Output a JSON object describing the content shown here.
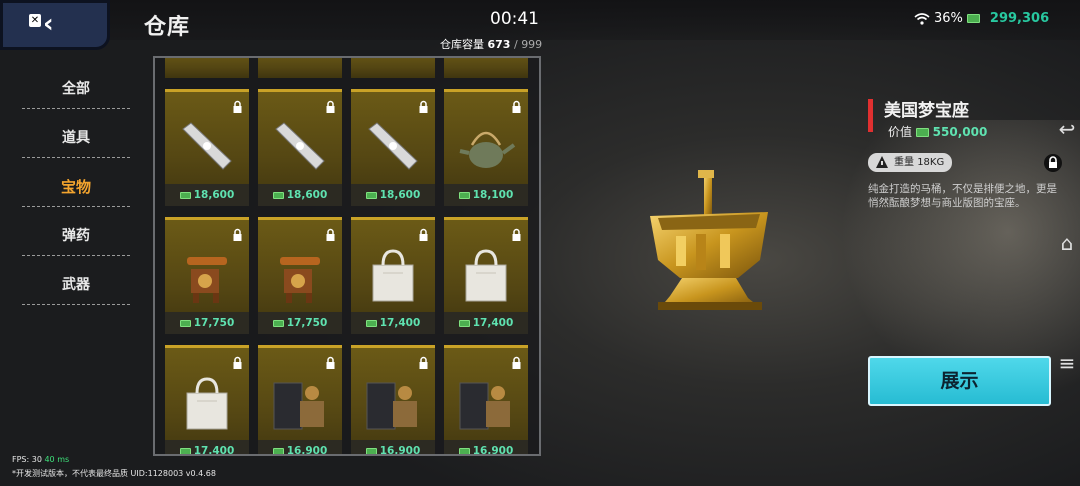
{
  "header": {
    "title": "仓库",
    "clock": "00:41",
    "capacity_label": "仓库容量",
    "capacity_used": "673",
    "capacity_sep": "/",
    "capacity_max": "999",
    "battery": "36%",
    "money": "299,306"
  },
  "sidebar": {
    "items": [
      {
        "label": "全部"
      },
      {
        "label": "道具"
      },
      {
        "label": "宝物",
        "active": true
      },
      {
        "label": "弹药"
      },
      {
        "label": "武器"
      }
    ]
  },
  "grid": {
    "items": [
      {
        "icon": "bar-item-icon",
        "price": "18,600"
      },
      {
        "icon": "bar-item-icon",
        "price": "18,600"
      },
      {
        "icon": "bar-item-icon",
        "price": "18,600"
      },
      {
        "icon": "teapot-icon",
        "price": "18,100"
      },
      {
        "icon": "telephone-icon",
        "price": "17,750"
      },
      {
        "icon": "telephone-icon",
        "price": "17,750"
      },
      {
        "icon": "bag-icon",
        "price": "17,400"
      },
      {
        "icon": "bag-icon",
        "price": "17,400"
      },
      {
        "icon": "bag-icon",
        "price": "17,400"
      },
      {
        "icon": "box-icon",
        "price": "16,900"
      },
      {
        "icon": "box-icon",
        "price": "16,900"
      },
      {
        "icon": "box-icon",
        "price": "16,900"
      }
    ]
  },
  "detail": {
    "name": "美国梦宝座",
    "value_label": "价值",
    "value": "550,000",
    "weight_label": "重量",
    "weight_value": "18KG",
    "description": "纯金打造的马桶，不仅是排便之地，更是悄然酝酿梦想与商业版图的宝座。",
    "show_button": "展示"
  },
  "footer": {
    "fps": "FPS: 30",
    "ping": "40 ms",
    "note": "*开发测试版本，不代表最终品质",
    "uid": "UID:1128003",
    "version": "v0.4.68"
  },
  "colors": {
    "accent_gold": "#f3a42e",
    "price_green": "#5fe2b0",
    "button_cyan": "#27bcd3"
  }
}
